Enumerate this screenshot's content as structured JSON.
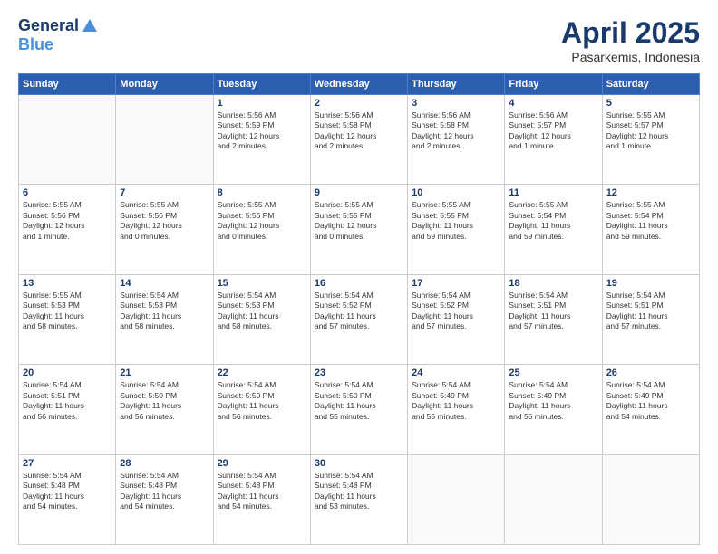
{
  "header": {
    "logo_general": "General",
    "logo_blue": "Blue",
    "month_year": "April 2025",
    "location": "Pasarkemis, Indonesia"
  },
  "weekdays": [
    "Sunday",
    "Monday",
    "Tuesday",
    "Wednesday",
    "Thursday",
    "Friday",
    "Saturday"
  ],
  "weeks": [
    [
      {
        "day": "",
        "detail": ""
      },
      {
        "day": "",
        "detail": ""
      },
      {
        "day": "1",
        "detail": "Sunrise: 5:56 AM\nSunset: 5:59 PM\nDaylight: 12 hours\nand 2 minutes."
      },
      {
        "day": "2",
        "detail": "Sunrise: 5:56 AM\nSunset: 5:58 PM\nDaylight: 12 hours\nand 2 minutes."
      },
      {
        "day": "3",
        "detail": "Sunrise: 5:56 AM\nSunset: 5:58 PM\nDaylight: 12 hours\nand 2 minutes."
      },
      {
        "day": "4",
        "detail": "Sunrise: 5:56 AM\nSunset: 5:57 PM\nDaylight: 12 hours\nand 1 minute."
      },
      {
        "day": "5",
        "detail": "Sunrise: 5:55 AM\nSunset: 5:57 PM\nDaylight: 12 hours\nand 1 minute."
      }
    ],
    [
      {
        "day": "6",
        "detail": "Sunrise: 5:55 AM\nSunset: 5:56 PM\nDaylight: 12 hours\nand 1 minute."
      },
      {
        "day": "7",
        "detail": "Sunrise: 5:55 AM\nSunset: 5:56 PM\nDaylight: 12 hours\nand 0 minutes."
      },
      {
        "day": "8",
        "detail": "Sunrise: 5:55 AM\nSunset: 5:56 PM\nDaylight: 12 hours\nand 0 minutes."
      },
      {
        "day": "9",
        "detail": "Sunrise: 5:55 AM\nSunset: 5:55 PM\nDaylight: 12 hours\nand 0 minutes."
      },
      {
        "day": "10",
        "detail": "Sunrise: 5:55 AM\nSunset: 5:55 PM\nDaylight: 11 hours\nand 59 minutes."
      },
      {
        "day": "11",
        "detail": "Sunrise: 5:55 AM\nSunset: 5:54 PM\nDaylight: 11 hours\nand 59 minutes."
      },
      {
        "day": "12",
        "detail": "Sunrise: 5:55 AM\nSunset: 5:54 PM\nDaylight: 11 hours\nand 59 minutes."
      }
    ],
    [
      {
        "day": "13",
        "detail": "Sunrise: 5:55 AM\nSunset: 5:53 PM\nDaylight: 11 hours\nand 58 minutes."
      },
      {
        "day": "14",
        "detail": "Sunrise: 5:54 AM\nSunset: 5:53 PM\nDaylight: 11 hours\nand 58 minutes."
      },
      {
        "day": "15",
        "detail": "Sunrise: 5:54 AM\nSunset: 5:53 PM\nDaylight: 11 hours\nand 58 minutes."
      },
      {
        "day": "16",
        "detail": "Sunrise: 5:54 AM\nSunset: 5:52 PM\nDaylight: 11 hours\nand 57 minutes."
      },
      {
        "day": "17",
        "detail": "Sunrise: 5:54 AM\nSunset: 5:52 PM\nDaylight: 11 hours\nand 57 minutes."
      },
      {
        "day": "18",
        "detail": "Sunrise: 5:54 AM\nSunset: 5:51 PM\nDaylight: 11 hours\nand 57 minutes."
      },
      {
        "day": "19",
        "detail": "Sunrise: 5:54 AM\nSunset: 5:51 PM\nDaylight: 11 hours\nand 57 minutes."
      }
    ],
    [
      {
        "day": "20",
        "detail": "Sunrise: 5:54 AM\nSunset: 5:51 PM\nDaylight: 11 hours\nand 56 minutes."
      },
      {
        "day": "21",
        "detail": "Sunrise: 5:54 AM\nSunset: 5:50 PM\nDaylight: 11 hours\nand 56 minutes."
      },
      {
        "day": "22",
        "detail": "Sunrise: 5:54 AM\nSunset: 5:50 PM\nDaylight: 11 hours\nand 56 minutes."
      },
      {
        "day": "23",
        "detail": "Sunrise: 5:54 AM\nSunset: 5:50 PM\nDaylight: 11 hours\nand 55 minutes."
      },
      {
        "day": "24",
        "detail": "Sunrise: 5:54 AM\nSunset: 5:49 PM\nDaylight: 11 hours\nand 55 minutes."
      },
      {
        "day": "25",
        "detail": "Sunrise: 5:54 AM\nSunset: 5:49 PM\nDaylight: 11 hours\nand 55 minutes."
      },
      {
        "day": "26",
        "detail": "Sunrise: 5:54 AM\nSunset: 5:49 PM\nDaylight: 11 hours\nand 54 minutes."
      }
    ],
    [
      {
        "day": "27",
        "detail": "Sunrise: 5:54 AM\nSunset: 5:48 PM\nDaylight: 11 hours\nand 54 minutes."
      },
      {
        "day": "28",
        "detail": "Sunrise: 5:54 AM\nSunset: 5:48 PM\nDaylight: 11 hours\nand 54 minutes."
      },
      {
        "day": "29",
        "detail": "Sunrise: 5:54 AM\nSunset: 5:48 PM\nDaylight: 11 hours\nand 54 minutes."
      },
      {
        "day": "30",
        "detail": "Sunrise: 5:54 AM\nSunset: 5:48 PM\nDaylight: 11 hours\nand 53 minutes."
      },
      {
        "day": "",
        "detail": ""
      },
      {
        "day": "",
        "detail": ""
      },
      {
        "day": "",
        "detail": ""
      }
    ]
  ]
}
